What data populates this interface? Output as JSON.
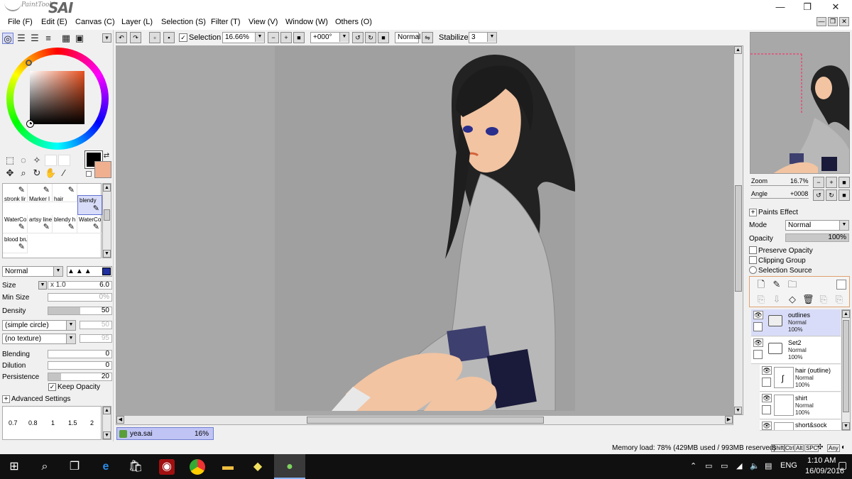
{
  "app": {
    "logo_small": "PaintTool",
    "logo_big": "SAI"
  },
  "window_controls": {
    "minimize": "—",
    "restore": "❐",
    "close": "✕"
  },
  "menu": [
    "File (F)",
    "Edit (E)",
    "Canvas (C)",
    "Layer (L)",
    "Selection (S)",
    "Filter (T)",
    "View (V)",
    "Window (W)",
    "Others (O)"
  ],
  "toolbar": {
    "selection_label": "Selection",
    "zoom": "16.66%",
    "angle": "+000°",
    "blend_mode": "Normal",
    "stabilizer_label": "Stabilizer",
    "stabilizer_value": "3"
  },
  "brushes": [
    {
      "name": "stronk lir",
      "icon": "pen-icon"
    },
    {
      "name": "Marker l",
      "icon": "marker-icon"
    },
    {
      "name": "hair",
      "icon": "brush-icon"
    },
    {
      "name": "blendy",
      "icon": "brush-icon",
      "selected": true
    },
    {
      "name": "WaterCo",
      "icon": "watercolor-icon"
    },
    {
      "name": "artsy line",
      "icon": "pen-icon"
    },
    {
      "name": "blendy h",
      "icon": "brush-icon"
    },
    {
      "name": "WaterCo",
      "icon": "watercolor-icon"
    },
    {
      "name": "blood bru",
      "icon": "brush-icon"
    }
  ],
  "brush_settings": {
    "mode": "Normal",
    "size_label": "Size",
    "size_mult": "x 1.0",
    "size_value": "6.0",
    "min_size_label": "Min Size",
    "min_size_value": "0%",
    "density_label": "Density",
    "density_value": "50",
    "shape": "(simple circle)",
    "shape_value": "50",
    "texture": "(no texture)",
    "texture_value": "95",
    "blending_label": "Blending",
    "blending_value": "0",
    "dilution_label": "Dilution",
    "dilution_value": "0",
    "persistence_label": "Persistence",
    "persistence_value": "20",
    "keep_opacity_label": "Keep Opacity",
    "advanced_label": "Advanced Settings",
    "size_presets": [
      "0.7",
      "0.8",
      "1",
      "1.5",
      "2"
    ]
  },
  "document_tab": {
    "name": "yea.sai",
    "zoom": "16%"
  },
  "navigator": {
    "zoom_label": "Zoom",
    "zoom_value": "16.7%",
    "angle_label": "Angle",
    "angle_value": "+0008"
  },
  "layer_panel": {
    "paint_effect": "Paints Effect",
    "mode_label": "Mode",
    "mode_value": "Normal",
    "opacity_label": "Opacity",
    "opacity_value": "100%",
    "preserve_opacity": "Preserve Opacity",
    "clipping_group": "Clipping Group",
    "selection_source": "Selection Source"
  },
  "layers": [
    {
      "name": "outlines",
      "mode": "Normal",
      "opacity": "100%",
      "type": "folder",
      "selected": true
    },
    {
      "name": "Set2",
      "mode": "Normal",
      "opacity": "100%",
      "type": "folder"
    },
    {
      "name": "hair (outline)",
      "mode": "Normal",
      "opacity": "100%",
      "type": "layer"
    },
    {
      "name": "shirt",
      "mode": "Normal",
      "opacity": "100%",
      "type": "layer"
    },
    {
      "name": "short&sock",
      "mode": "",
      "opacity": "",
      "type": "layer"
    }
  ],
  "status": {
    "memory": "Memory load: 78% (429MB used / 993MB reserved)",
    "keys": [
      "Shift",
      "Ctrl",
      "Alt",
      "SPC",
      "Any"
    ]
  },
  "taskbar": {
    "time": "1:10 AM",
    "date": "16/09/2016",
    "lang": "ENG"
  },
  "colors": {
    "foreground": "#000000",
    "background_swatch": "#f0b090",
    "selection_accent": "#d8dcf8"
  }
}
